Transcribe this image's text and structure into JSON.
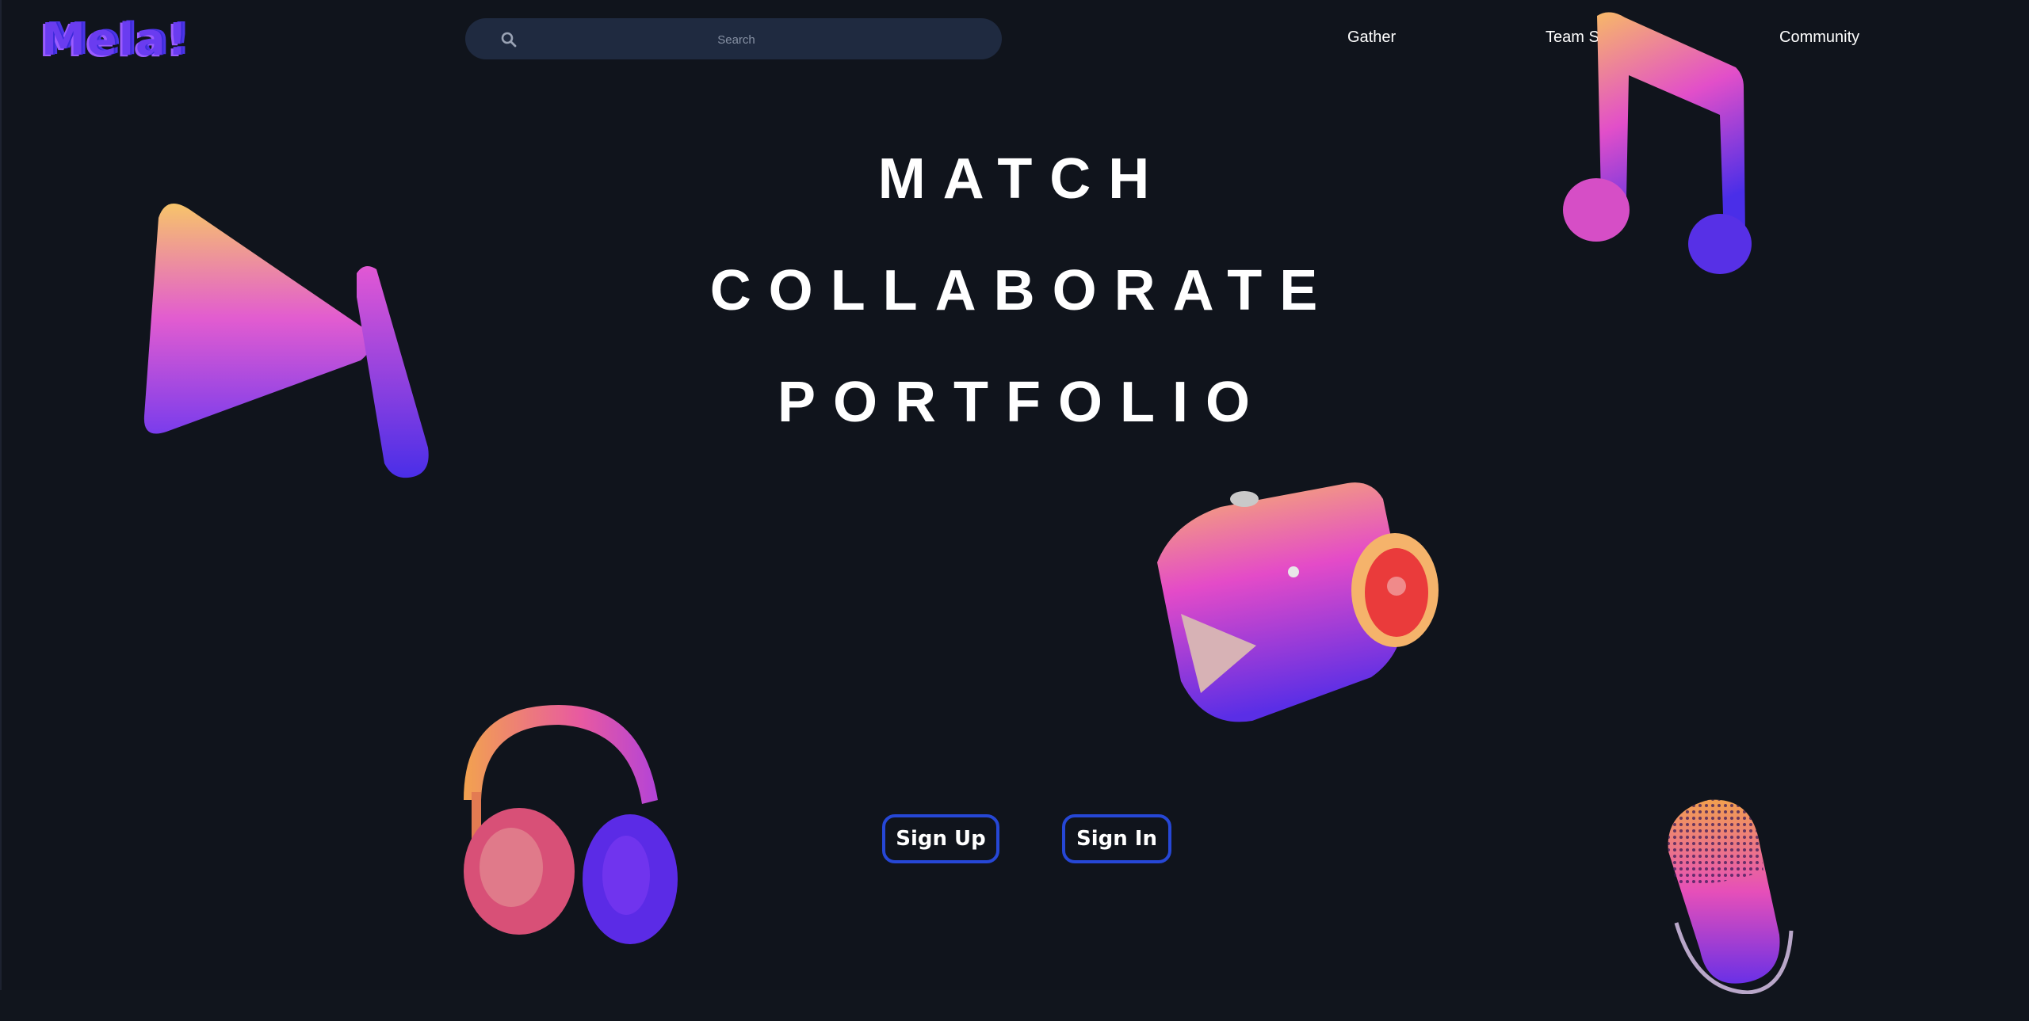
{
  "header": {
    "logo_text": "Mela!",
    "search": {
      "placeholder": "Search"
    },
    "nav": [
      {
        "label": "Gather"
      },
      {
        "label": "Team Space"
      },
      {
        "label": "Community"
      }
    ]
  },
  "hero": {
    "lines": [
      "MATCH",
      "COLLABORATE",
      "PORTFOLIO"
    ]
  },
  "actions": {
    "sign_up": "Sign Up",
    "sign_in": "Sign In"
  },
  "decorations": {
    "icons": [
      "play-button-3d-icon",
      "music-note-3d-icon",
      "video-camera-3d-icon",
      "headphones-3d-icon",
      "microphone-3d-icon"
    ],
    "colors": {
      "accent_orange": "#f5b36b",
      "accent_pink": "#d94fd0",
      "accent_purple": "#5a2ee6",
      "button_border": "#2647d6",
      "background": "#10141c"
    }
  }
}
